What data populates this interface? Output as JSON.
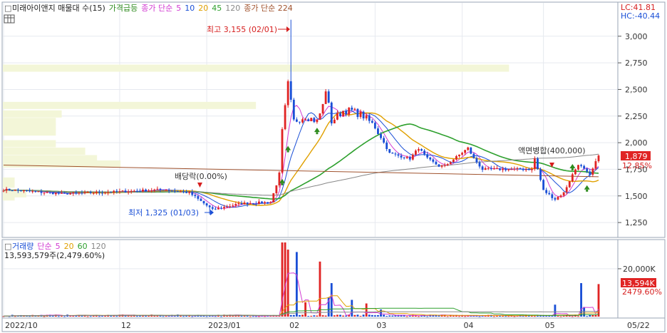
{
  "header": {
    "price_legend": [
      {
        "label": "미래아이앤지 매물대 수(15)",
        "color": "#222222"
      },
      {
        "label": "가격급등",
        "color": "#2e8b1e"
      },
      {
        "label": "종가 단순",
        "color": "#d23bd2"
      },
      {
        "label": "5",
        "color": "#d23bd2"
      },
      {
        "label": "10",
        "color": "#1a4fd6"
      },
      {
        "label": "20",
        "color": "#e0a000"
      },
      {
        "label": "45",
        "color": "#2ea02e"
      },
      {
        "label": "120",
        "color": "#888888"
      },
      {
        "label": "종가 단순 224",
        "color": "#a0522d"
      }
    ],
    "lc_label": "LC:41.81",
    "hc_label": "HC:-40.44"
  },
  "volume_legend": {
    "items": [
      {
        "label": "거래량",
        "color": "#1a4fd6"
      },
      {
        "label": "단순",
        "color": "#d23bd2"
      },
      {
        "label": "5",
        "color": "#d23bd2"
      },
      {
        "label": "20",
        "color": "#e0a000"
      },
      {
        "label": "60",
        "color": "#2ea02e"
      },
      {
        "label": "120",
        "color": "#888888"
      }
    ],
    "summary": "13,593,579주(2,479.60%)"
  },
  "annotations": {
    "high_label": "최고 3,155 (02/01)",
    "low_label": "최저 1,325 (01/03)",
    "dividend_label": "배당락(0.00%)",
    "split_label": "액면병합(400,000)"
  },
  "price_badges": {
    "last_price": "1,879",
    "change_pct": "12.85%"
  },
  "volume_badges": {
    "last_volume": "13,594K",
    "pct": "2479.60%"
  },
  "chart_data": {
    "type": "candlestick",
    "price_axis": {
      "ticks": [
        1250,
        1500,
        1750,
        2000,
        2250,
        2500,
        2750,
        3000
      ],
      "tick_labels": [
        "1,250",
        "1,500",
        "1,750",
        "2,000",
        "2,250",
        "2,500",
        "2,750",
        "3,000"
      ],
      "range": [
        1130,
        3300
      ]
    },
    "volume_axis": {
      "ticks": [
        20000
      ],
      "tick_labels": [
        "20,000K"
      ],
      "range": [
        0,
        31000
      ]
    },
    "x_axis": {
      "labels": [
        {
          "label": "2022/10",
          "index": 0
        },
        {
          "label": "12",
          "index": 40
        },
        {
          "label": "2023/01",
          "index": 70
        },
        {
          "label": "02",
          "index": 98
        },
        {
          "label": "03",
          "index": 128
        },
        {
          "label": "04",
          "index": 158
        },
        {
          "label": "05",
          "index": 186
        },
        {
          "label": "05/22",
          "index": 219
        }
      ],
      "count": 206
    },
    "series_names": [
      "종가 단순 5",
      "10",
      "20",
      "45",
      "120",
      "종가 단순 224"
    ],
    "ohlc_anchors": [
      [
        0,
        1560
      ],
      [
        20,
        1520
      ],
      [
        40,
        1540
      ],
      [
        55,
        1560
      ],
      [
        64,
        1530
      ],
      [
        72,
        1370
      ],
      [
        82,
        1430
      ],
      [
        92,
        1440
      ],
      [
        95,
        1690
      ],
      [
        96,
        2100
      ],
      [
        98,
        2550
      ],
      [
        100,
        2200
      ],
      [
        104,
        2250
      ],
      [
        108,
        2200
      ],
      [
        110,
        2350
      ],
      [
        111,
        2500
      ],
      [
        113,
        2200
      ],
      [
        117,
        2300
      ],
      [
        120,
        2300
      ],
      [
        124,
        2250
      ],
      [
        128,
        2150
      ],
      [
        133,
        1900
      ],
      [
        140,
        1850
      ],
      [
        143,
        1950
      ],
      [
        146,
        1850
      ],
      [
        150,
        1780
      ],
      [
        152,
        1780
      ],
      [
        160,
        1950
      ],
      [
        162,
        1850
      ],
      [
        165,
        1750
      ],
      [
        172,
        1750
      ],
      [
        182,
        1750
      ],
      [
        183,
        1850
      ],
      [
        186,
        1550
      ],
      [
        190,
        1470
      ],
      [
        193,
        1530
      ],
      [
        196,
        1700
      ],
      [
        198,
        1800
      ],
      [
        200,
        1750
      ],
      [
        202,
        1690
      ],
      [
        205,
        1879
      ]
    ],
    "highlights": {
      "high": {
        "index": 99,
        "price": 3155
      },
      "low": {
        "index": 71,
        "price": 1325
      },
      "last": {
        "index": 205,
        "close": 1879
      }
    },
    "volume_spikes": [
      [
        96,
        31000
      ],
      [
        97,
        31000
      ],
      [
        98,
        28000
      ],
      [
        101,
        27000
      ],
      [
        109,
        23000
      ],
      [
        113,
        14000
      ],
      [
        112,
        8000
      ],
      [
        104,
        6000
      ],
      [
        120,
        7000
      ],
      [
        125,
        5500
      ],
      [
        130,
        3000
      ],
      [
        190,
        5000
      ],
      [
        199,
        14000
      ],
      [
        200,
        4000
      ],
      [
        205,
        13594
      ]
    ],
    "volume_profile_levels": [
      2700,
      2350,
      2270,
      2200,
      2150,
      2100,
      1990,
      1920,
      1850,
      1800,
      1640,
      1610,
      1520,
      1490
    ],
    "volume_profile_weights": [
      0.86,
      0.43,
      0.1,
      0.09,
      0.09,
      0.09,
      0.09,
      0.14,
      0.16,
      0.2,
      0.02,
      0.02,
      0.04,
      0.02
    ]
  }
}
